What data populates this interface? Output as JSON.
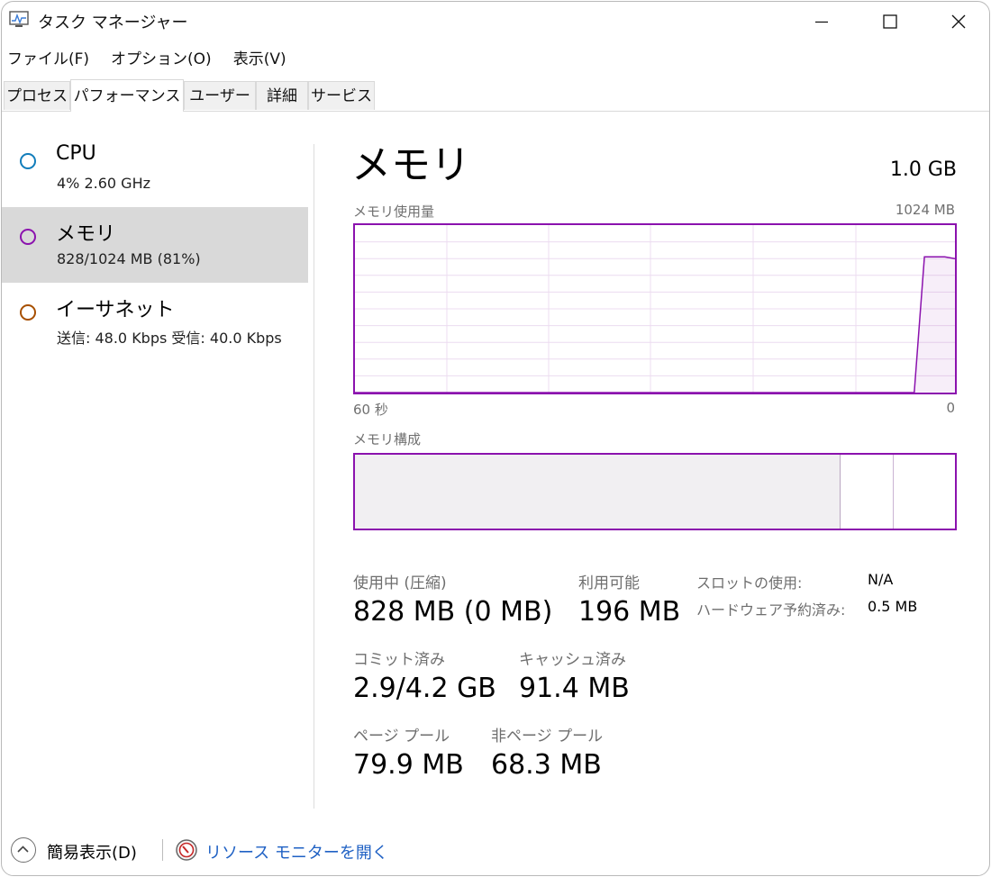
{
  "window": {
    "title": "タスク マネージャー",
    "icon": "task-manager-icon"
  },
  "menu": [
    "ファイル(F)",
    "オプション(O)",
    "表示(V)"
  ],
  "tabs": [
    {
      "label": "プロセス",
      "active": false
    },
    {
      "label": "パフォーマンス",
      "active": true
    },
    {
      "label": "ユーザー",
      "active": false
    },
    {
      "label": "詳細",
      "active": false
    },
    {
      "label": "サービス",
      "active": false
    }
  ],
  "sidebar": {
    "items": [
      {
        "name": "CPU",
        "detail": "4%  2.60 GHz",
        "color": "#117dbb",
        "selected": false
      },
      {
        "name": "メモリ",
        "detail": "828/1024 MB (81%)",
        "color": "#8b12ae",
        "selected": true
      },
      {
        "name": "イーサネット",
        "detail": "送信: 48.0 Kbps 受信: 40.0 Kbps",
        "color": "#a74f01",
        "selected": false
      }
    ]
  },
  "main": {
    "title": "メモリ",
    "total": "1.0 GB",
    "usage_label": "メモリ使用量",
    "usage_max": "1024 MB",
    "axis_left": "60 秒",
    "axis_right": "0",
    "composition_label": "メモリ構成",
    "accent_color": "#8b12ae",
    "usage_history_fraction": [
      0.0,
      0.0,
      0.0,
      0.0,
      0.0,
      0.0,
      0.0,
      0.0,
      0.0,
      0.0,
      0.0,
      0.0,
      0.0,
      0.0,
      0.0,
      0.0,
      0.0,
      0.0,
      0.0,
      0.0,
      0.0,
      0.0,
      0.0,
      0.0,
      0.0,
      0.0,
      0.0,
      0.0,
      0.0,
      0.0,
      0.0,
      0.0,
      0.0,
      0.0,
      0.0,
      0.0,
      0.0,
      0.0,
      0.0,
      0.0,
      0.0,
      0.0,
      0.0,
      0.0,
      0.0,
      0.0,
      0.0,
      0.0,
      0.0,
      0.0,
      0.0,
      0.0,
      0.0,
      0.0,
      0.0,
      0.0,
      0.81,
      0.81,
      0.81,
      0.8
    ],
    "composition": {
      "in_use_mb": 828,
      "modified_mb": 91.4,
      "total_mb": 1024
    },
    "stats": {
      "in_use_label": "使用中 (圧縮)",
      "in_use_value": "828 MB (0 MB)",
      "available_label": "利用可能",
      "available_value": "196 MB",
      "slots_label": "スロットの使用:",
      "slots_value": "N/A",
      "reserved_label": "ハードウェア予約済み:",
      "reserved_value": "0.5 MB",
      "committed_label": "コミット済み",
      "committed_value": "2.9/4.2 GB",
      "cached_label": "キャッシュ済み",
      "cached_value": "91.4 MB",
      "paged_label": "ページ プール",
      "paged_value": "79.9 MB",
      "nonpaged_label": "非ページ プール",
      "nonpaged_value": "68.3 MB"
    }
  },
  "footer": {
    "toggle_label": "簡易表示(D)",
    "link_label": "リソース モニターを開く",
    "link_color": "#1f61c4"
  }
}
